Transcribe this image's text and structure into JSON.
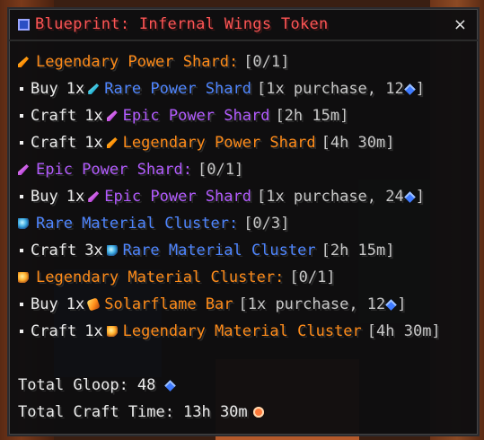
{
  "window": {
    "title": "Blueprint: Infernal Wings Token",
    "close_label": "×"
  },
  "icons": {
    "title": "blueprint-icon",
    "close": "close-icon"
  },
  "colors": {
    "title": "#ff5555",
    "legendary": "#ff8c1a",
    "epic": "#b35cff",
    "rare": "#4f86ff",
    "text": "#ececec"
  },
  "lines": [
    {
      "bullet": false,
      "icon": "legendary-power-shard-icon",
      "action": "",
      "qty": "",
      "item": "Legendary Power Shard",
      "suffix": ":",
      "detail": "[0/1]",
      "color": "orange"
    },
    {
      "bullet": true,
      "icon": "rare-power-shard-icon",
      "action": "Buy",
      "qty": "1x",
      "item": "Rare Power Shard",
      "suffix": "",
      "detail": "[1x purchase, 12",
      "tail": "]",
      "gem": true,
      "color": "blue"
    },
    {
      "bullet": true,
      "icon": "epic-power-shard-icon",
      "action": "Craft",
      "qty": "1x",
      "item": "Epic Power Shard",
      "suffix": "",
      "detail": "[2h 15m]",
      "color": "purple"
    },
    {
      "bullet": true,
      "icon": "legendary-power-shard-icon",
      "action": "Craft",
      "qty": "1x",
      "item": "Legendary Power Shard",
      "suffix": "",
      "detail": "[4h 30m]",
      "color": "orange"
    },
    {
      "bullet": false,
      "icon": "epic-power-shard-icon",
      "action": "",
      "qty": "",
      "item": "Epic Power Shard",
      "suffix": ":",
      "detail": "[0/1]",
      "color": "purple"
    },
    {
      "bullet": true,
      "icon": "epic-power-shard-icon",
      "action": "Buy",
      "qty": "1x",
      "item": "Epic Power Shard",
      "suffix": "",
      "detail": "[1x purchase, 24",
      "tail": "]",
      "gem": true,
      "color": "purple"
    },
    {
      "bullet": false,
      "icon": "rare-material-cluster-icon",
      "action": "",
      "qty": "",
      "item": "Rare Material Cluster",
      "suffix": ":",
      "detail": "[0/3]",
      "color": "blue"
    },
    {
      "bullet": true,
      "icon": "rare-material-cluster-icon",
      "action": "Craft",
      "qty": "3x",
      "item": "Rare Material Cluster",
      "suffix": "",
      "detail": "[2h 15m]",
      "color": "blue"
    },
    {
      "bullet": false,
      "icon": "legendary-material-cluster-icon",
      "action": "",
      "qty": "",
      "item": "Legendary Material Cluster",
      "suffix": ":",
      "detail": "[0/1]",
      "color": "orange"
    },
    {
      "bullet": true,
      "icon": "solarflame-bar-icon",
      "action": "Buy",
      "qty": "1x",
      "item": "Solarflame Bar",
      "suffix": "",
      "detail": "[1x purchase, 12",
      "tail": "]",
      "gem": true,
      "color": "orange"
    },
    {
      "bullet": true,
      "icon": "legendary-material-cluster-icon",
      "action": "Craft",
      "qty": "1x",
      "item": "Legendary Material Cluster",
      "suffix": "",
      "detail": "[4h 30m]",
      "color": "orange"
    }
  ],
  "footer": {
    "total_gloop_label": "Total Gloop:",
    "total_gloop_value": "48",
    "total_gloop_icon": "gloop-gem-icon",
    "total_time_label": "Total Craft Time:",
    "total_time_value": "13h 30m",
    "total_time_icon": "clock-icon"
  }
}
